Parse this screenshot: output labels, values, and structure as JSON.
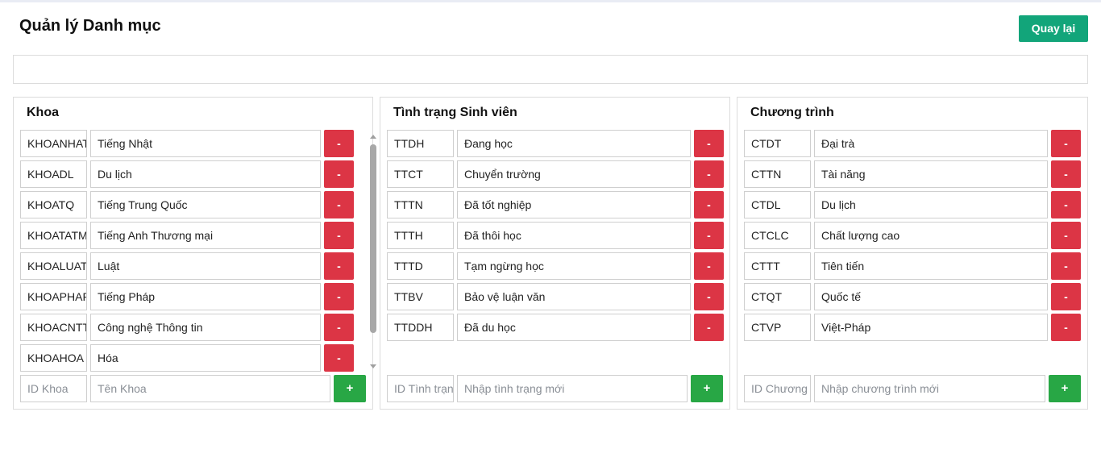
{
  "header": {
    "title": "Quản lý Danh mục",
    "back_label": "Quay lại"
  },
  "colors": {
    "back_button": "#12a57a",
    "delete_button": "#dc3545",
    "add_button": "#28a745",
    "border": "#dcdcdc"
  },
  "icons": {
    "delete": "minus-icon",
    "add": "plus-icon"
  },
  "panels": {
    "khoa": {
      "title": "Khoa",
      "items": [
        {
          "id": "KHOANHAT",
          "name": "Tiếng Nhật"
        },
        {
          "id": "KHOADL",
          "name": "Du lịch"
        },
        {
          "id": "KHOATQ",
          "name": "Tiếng Trung Quốc"
        },
        {
          "id": "KHOATATM",
          "name": "Tiếng Anh Thương mại"
        },
        {
          "id": "KHOALUAT",
          "name": "Luật"
        },
        {
          "id": "KHOAPHAP",
          "name": "Tiếng Pháp"
        },
        {
          "id": "KHOACNTT",
          "name": "Công nghệ Thông tin"
        },
        {
          "id": "KHOAHOA",
          "name": "Hóa"
        }
      ],
      "delete_label": "-",
      "add_label": "+",
      "id_placeholder": "ID Khoa",
      "name_placeholder": "Tên Khoa"
    },
    "tinhtrang": {
      "title": "Tình trạng Sinh viên",
      "items": [
        {
          "id": "TTDH",
          "name": "Đang học"
        },
        {
          "id": "TTCT",
          "name": "Chuyển trường"
        },
        {
          "id": "TTTN",
          "name": "Đã tốt nghiệp"
        },
        {
          "id": "TTTH",
          "name": "Đã thôi học"
        },
        {
          "id": "TTTD",
          "name": "Tạm ngừng học"
        },
        {
          "id": "TTBV",
          "name": "Bảo vệ luận văn"
        },
        {
          "id": "TTDDH",
          "name": "Đã du học"
        }
      ],
      "delete_label": "-",
      "add_label": "+",
      "id_placeholder": "ID Tình trạng",
      "name_placeholder": "Nhập tình trạng mới"
    },
    "chuongtrinh": {
      "title": "Chương trình",
      "items": [
        {
          "id": "CTDT",
          "name": "Đại trà"
        },
        {
          "id": "CTTN",
          "name": "Tài năng"
        },
        {
          "id": "CTDL",
          "name": "Du lịch"
        },
        {
          "id": "CTCLC",
          "name": "Chất lượng cao"
        },
        {
          "id": "CTTT",
          "name": "Tiên tiến"
        },
        {
          "id": "CTQT",
          "name": "Quốc tế"
        },
        {
          "id": "CTVP",
          "name": "Việt-Pháp"
        }
      ],
      "delete_label": "-",
      "add_label": "+",
      "id_placeholder": "ID Chương trình",
      "name_placeholder": "Nhập chương trình mới"
    }
  }
}
